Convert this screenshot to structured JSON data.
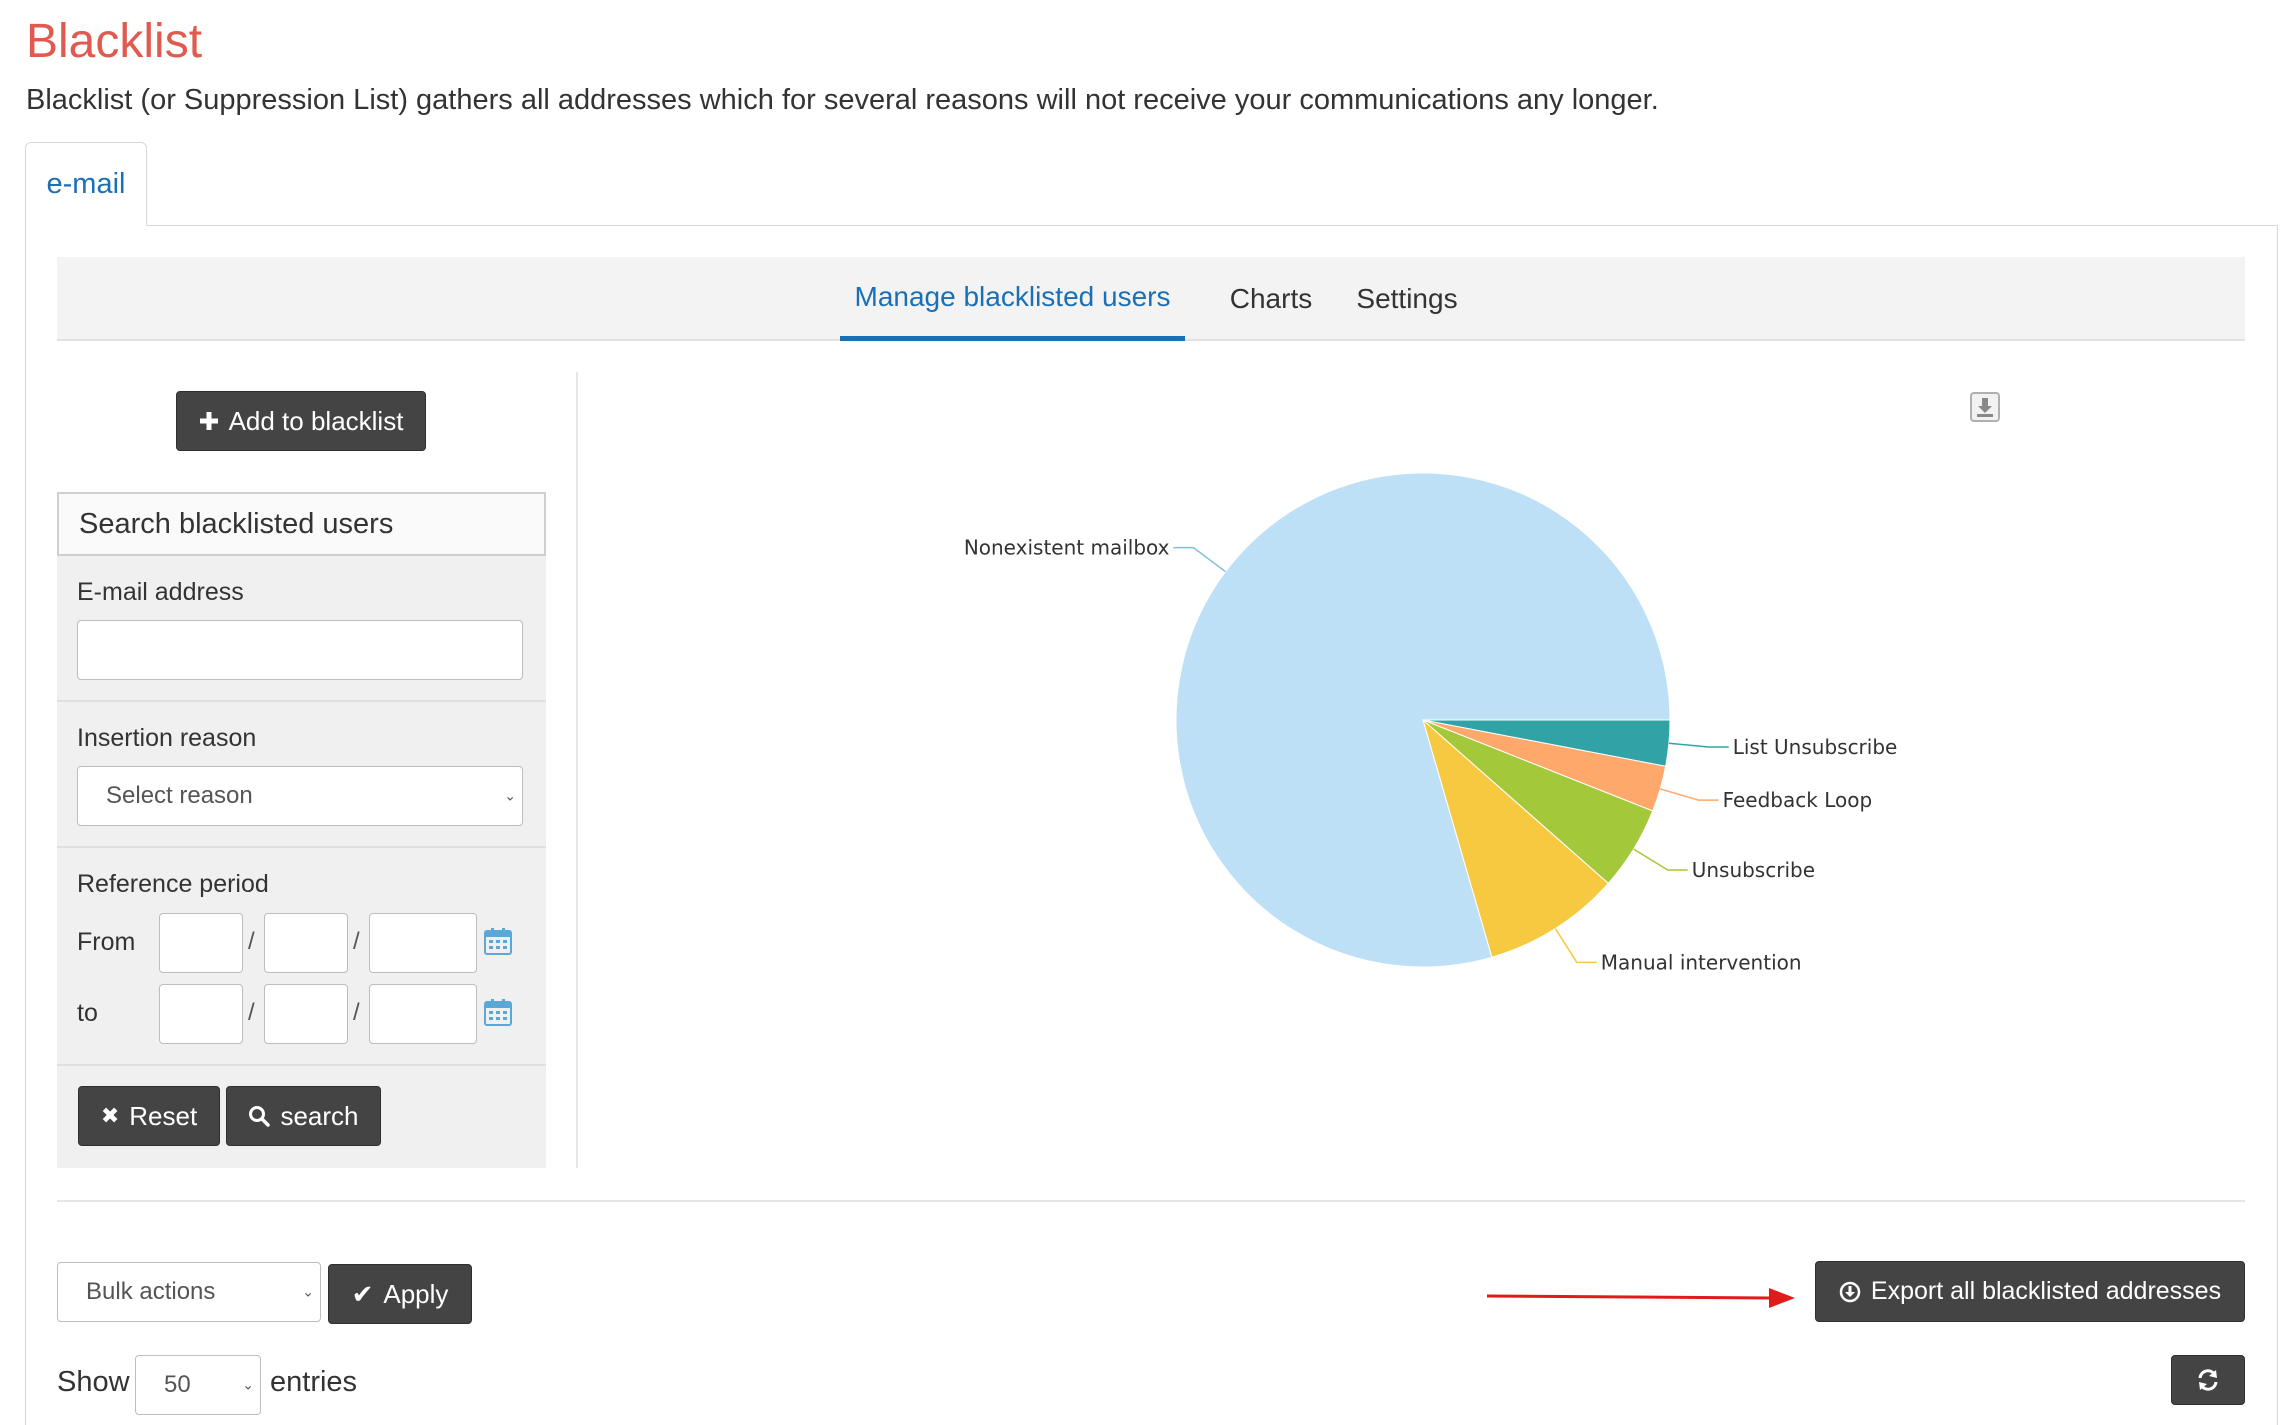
{
  "page": {
    "title": "Blacklist",
    "subtitle": "Blacklist (or Suppression List) gathers all addresses which for several reasons will not receive your communications any longer.",
    "outer_tab": "e-mail"
  },
  "subtabs": [
    {
      "label": "Manage blacklisted users",
      "active": true
    },
    {
      "label": "Charts",
      "active": false
    },
    {
      "label": "Settings",
      "active": false
    }
  ],
  "sidebar": {
    "add_button": "Add to blacklist",
    "search_title": "Search blacklisted users",
    "email_label": "E-mail address",
    "email_value": "",
    "reason_label": "Insertion reason",
    "reason_placeholder": "Select reason",
    "period_label": "Reference period",
    "from_label": "From",
    "to_label": "to",
    "date_separator": "/",
    "reset_button": "Reset",
    "search_button": "search"
  },
  "chart_data": {
    "type": "pie",
    "title": "",
    "categories": [
      "Nonexistent mailbox",
      "List Unsubscribe",
      "Feedback Loop",
      "Unsubscribe",
      "Manual intervention"
    ],
    "values": [
      79.5,
      3.0,
      3.0,
      5.5,
      9.0
    ],
    "colors": [
      "#bde0f7",
      "#31a3a6",
      "#ffa86b",
      "#a3c93a",
      "#f6c940"
    ],
    "labels_outside": true
  },
  "bottom": {
    "bulk_placeholder": "Bulk actions",
    "apply_button": "Apply",
    "export_button": "Export all blacklisted addresses",
    "show_label": "Show",
    "entries_value": "50",
    "entries_label": "entries"
  },
  "colors": {
    "title": "#e05a4f",
    "accent": "#1a6fb5",
    "button_dark": "#444444",
    "annotation_arrow": "#e01b1b"
  }
}
